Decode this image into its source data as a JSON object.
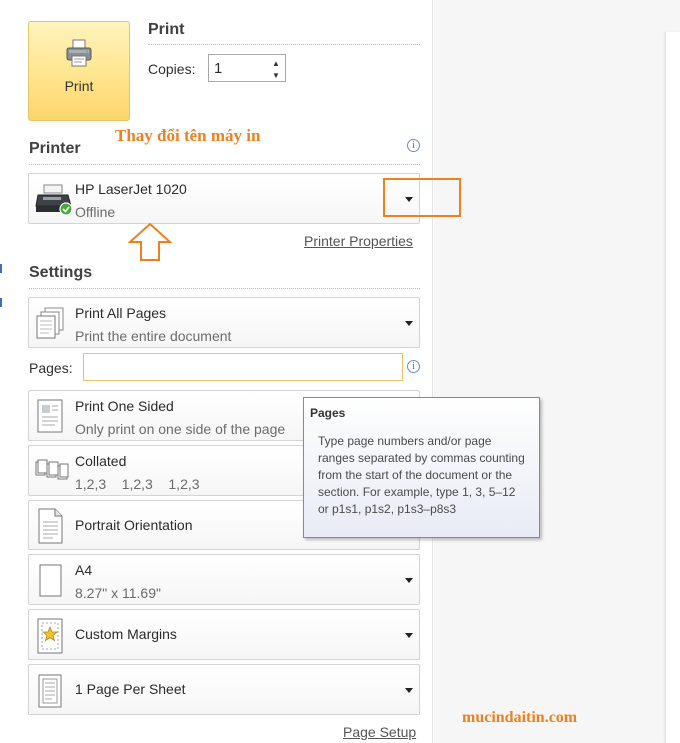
{
  "print": {
    "button_label": "Print",
    "section_title": "Print",
    "copies_label": "Copies:",
    "copies_value": "1"
  },
  "annotation": {
    "text": "Thay đổi tên máy in",
    "color": "#f0801e"
  },
  "printer": {
    "section_title": "Printer",
    "name": "HP LaserJet 1020",
    "status": "Offline",
    "properties_link": "Printer Properties"
  },
  "settings": {
    "section_title": "Settings",
    "print_range": {
      "label": "Print All Pages",
      "description": "Print the entire document"
    },
    "pages_label": "Pages:",
    "pages_value": "",
    "sides": {
      "label": "Print One Sided",
      "description": "Only print on one side of the page"
    },
    "collation": {
      "label": "Collated",
      "description": "1,2,3    1,2,3    1,2,3"
    },
    "orientation": {
      "label": "Portrait Orientation"
    },
    "paper_size": {
      "label": "A4",
      "description": "8.27\" x 11.69\""
    },
    "margins": {
      "label": "Custom Margins"
    },
    "pages_per_sheet": {
      "label": "1 Page Per Sheet"
    },
    "page_setup_link": "Page Setup"
  },
  "tooltip": {
    "title": "Pages",
    "body": "Type page numbers and/or page ranges separated by commas counting from the start of the document or the section. For example, type 1, 3, 5–12 or p1s1, p1s2, p1s3–p8s3"
  },
  "watermark": {
    "text": "mucindaitin.com"
  },
  "colors": {
    "accent_orange": "#f0801e",
    "print_button": "#ffe58e"
  }
}
